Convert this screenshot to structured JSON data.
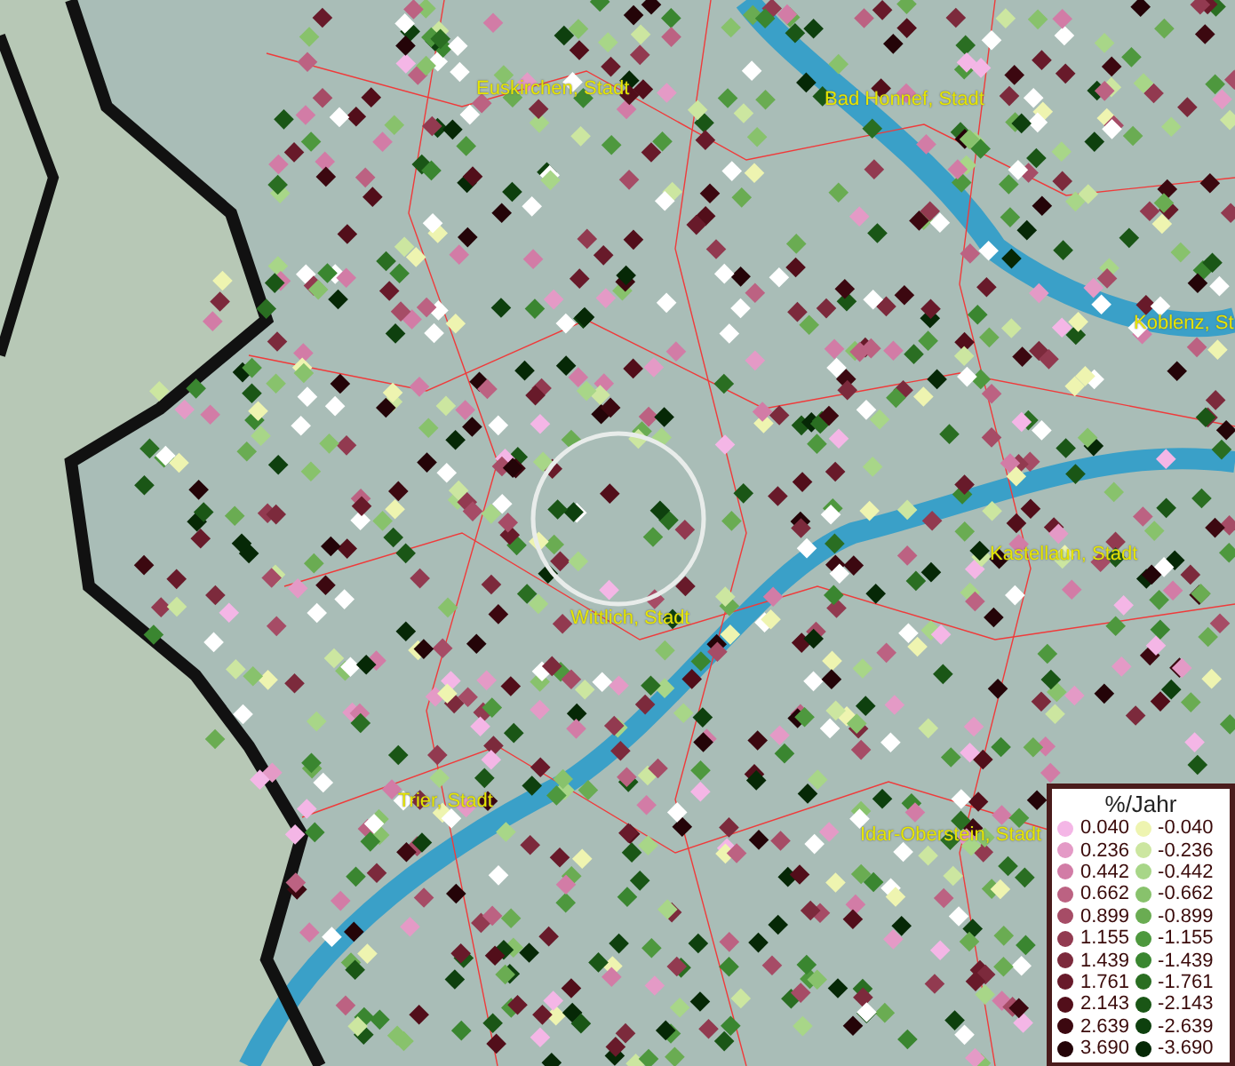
{
  "map": {
    "places": [
      {
        "name": "Euskirchen, Stadt"
      },
      {
        "name": "Bad Honnef, Stadt"
      },
      {
        "name": "Koblenz, St"
      },
      {
        "name": "Kastellaun, Stadt"
      },
      {
        "name": "Wittlich, Stadt"
      },
      {
        "name": "Trier, Stadt"
      },
      {
        "name": "Idar-Oberstein, Stadt"
      }
    ]
  },
  "legend": {
    "title": "%/Jahr",
    "columns": [
      [
        {
          "label": "0.040",
          "color": "#f4b6e6"
        },
        {
          "label": "0.236",
          "color": "#e49ac6"
        },
        {
          "label": "0.442",
          "color": "#d27ca6"
        },
        {
          "label": "0.662",
          "color": "#bc6282"
        },
        {
          "label": "0.899",
          "color": "#a64c66"
        },
        {
          "label": "1.155",
          "color": "#923a50"
        },
        {
          "label": "1.439",
          "color": "#7c2a3c"
        },
        {
          "label": "1.761",
          "color": "#681a2a"
        },
        {
          "label": "2.143",
          "color": "#520e1a"
        },
        {
          "label": "2.639",
          "color": "#3c0810"
        },
        {
          "label": "3.690",
          "color": "#240408"
        }
      ],
      [
        {
          "label": "-0.040",
          "color": "#eef4b0"
        },
        {
          "label": "-0.236",
          "color": "#cce6a0"
        },
        {
          "label": "-0.442",
          "color": "#a8d688"
        },
        {
          "label": "-0.662",
          "color": "#88c26c"
        },
        {
          "label": "-0.899",
          "color": "#6aac52"
        },
        {
          "label": "-1.155",
          "color": "#4e983e"
        },
        {
          "label": "-1.439",
          "color": "#3a8630"
        },
        {
          "label": "-1.761",
          "color": "#2a6e22"
        },
        {
          "label": "-2.143",
          "color": "#1a5616"
        },
        {
          "label": "-2.639",
          "color": "#0e400e"
        },
        {
          "label": "-3.690",
          "color": "#062806"
        }
      ]
    ]
  }
}
